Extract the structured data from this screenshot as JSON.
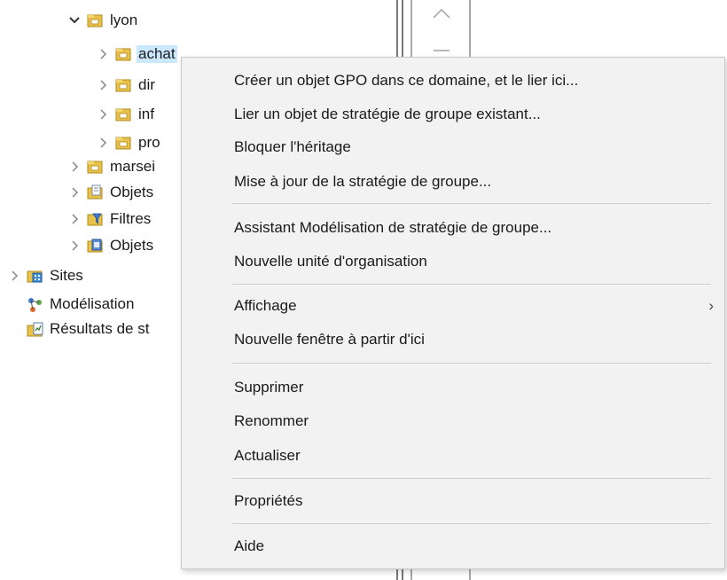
{
  "tree": {
    "nodes": [
      {
        "id": "lyon",
        "label": "lyon",
        "expanded": true,
        "icon": "ou-folder-icon"
      },
      {
        "id": "achat",
        "label": "achat",
        "expanded": false,
        "icon": "ou-folder-icon",
        "selected": true
      },
      {
        "id": "dir",
        "label": "dir",
        "expanded": false,
        "icon": "ou-folder-icon"
      },
      {
        "id": "inf",
        "label": "inf",
        "expanded": false,
        "icon": "ou-folder-icon"
      },
      {
        "id": "pro",
        "label": "pro",
        "expanded": false,
        "icon": "ou-folder-icon"
      },
      {
        "id": "marseille",
        "label": "marsei",
        "expanded": false,
        "icon": "ou-folder-icon"
      },
      {
        "id": "objets-gpo",
        "label": "Objets",
        "expanded": false,
        "icon": "gpo-objects-icon"
      },
      {
        "id": "filtres-wmi",
        "label": "Filtres",
        "expanded": false,
        "icon": "wmi-filter-icon"
      },
      {
        "id": "objets-starter",
        "label": "Objets",
        "expanded": false,
        "icon": "starter-gpo-icon"
      },
      {
        "id": "sites",
        "label": "Sites",
        "expanded": false,
        "icon": "sites-icon"
      },
      {
        "id": "modelisation",
        "label": "Modélisation",
        "icon": "modeling-icon"
      },
      {
        "id": "resultats",
        "label": "Résultats de st",
        "icon": "results-icon"
      }
    ]
  },
  "context_menu": {
    "groups": [
      [
        "Créer un objet GPO dans ce domaine, et le lier ici...",
        "Lier un objet de stratégie de groupe existant...",
        "Bloquer l'héritage",
        "Mise à jour de la stratégie de groupe..."
      ],
      [
        "Assistant Modélisation de stratégie de groupe...",
        "Nouvelle unité d'organisation"
      ],
      [
        "Affichage",
        "Nouvelle fenêtre à partir d'ici"
      ],
      [
        "Supprimer",
        "Renommer",
        "Actualiser"
      ],
      [
        "Propriétés"
      ],
      [
        "Aide"
      ]
    ],
    "submenu_arrow": "›",
    "colors": {
      "background": "#f2f2f2",
      "separator": "#d0d0d0",
      "selection": "#cce8ff"
    }
  }
}
